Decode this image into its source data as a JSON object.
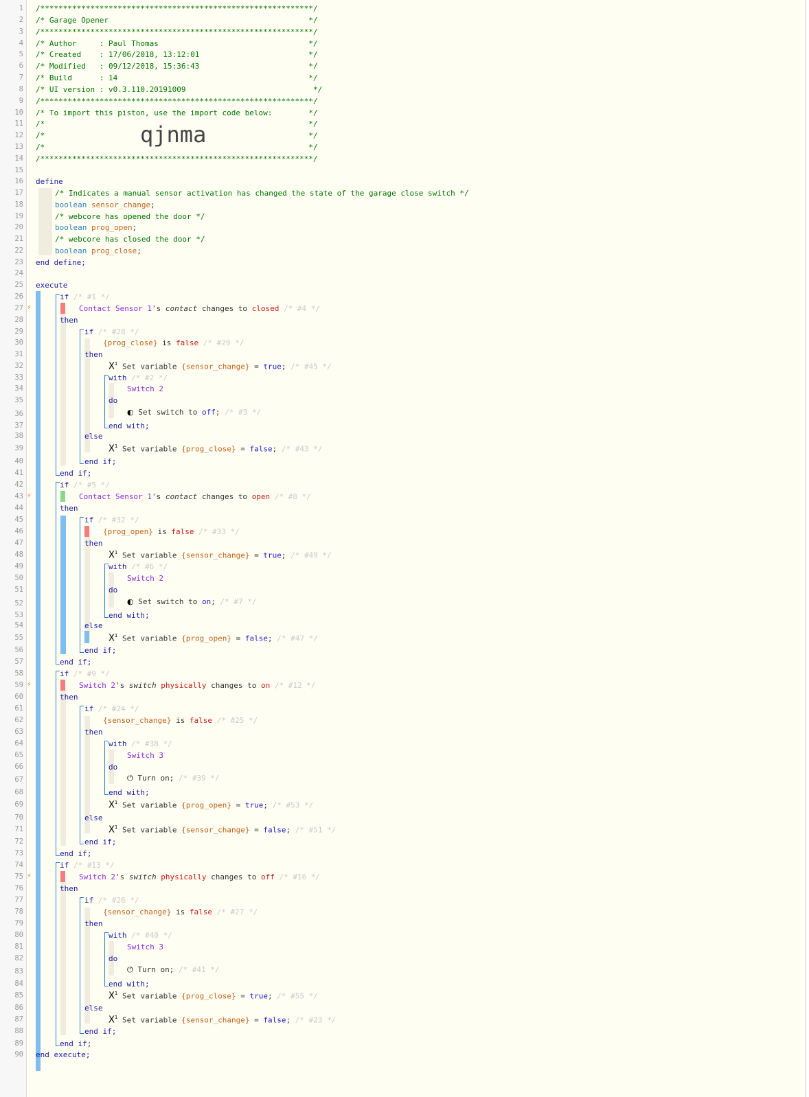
{
  "header": {
    "l1": "/************************************************************/",
    "title": "/* Garage Opener                                            */",
    "l3": "/************************************************************/",
    "author": "/* Author     : Paul Thomas                                 */",
    "created": "/* Created    : 17/06/2018, 13:12:01                        */",
    "modified": "/* Modified   : 09/12/2018, 15:36:43                        */",
    "build": "/* Build      : 14                                          */",
    "uiver": "/* UI version : v0.3.110.20191009                            */",
    "l9": "/************************************************************/",
    "import": "/* To import this piston, use the import code below:        */",
    "l11": "/*                                                          */",
    "l12": "/*                                                          */",
    "l13": "/*                                                          */",
    "l14": "/************************************************************/",
    "code": "qjnma"
  },
  "kw": {
    "define": "define",
    "enddefine": "end define;",
    "execute": "execute",
    "endexecute": "end execute;",
    "if": "if",
    "then": "then",
    "else": "else",
    "endif": "end if;",
    "with": "with",
    "do": "do",
    "endwith": "end with;",
    "boolean": "boolean",
    "is": "is",
    "false": "false",
    "true": "true",
    "changes": "changes to",
    "setvar": "Set variable",
    "setswitch": "Set switch to",
    "turnon": "Turn on;",
    "s": "'s",
    "eq": "=",
    "semi": ";",
    "physically": "physically"
  },
  "defs": {
    "c1": "/* Indicates a manual sensor activation has changed the state of the garage close switch */",
    "v1": "sensor_change",
    "c2": "/* webcore has opened the door */",
    "v2": "prog_open",
    "c3": "/* webcore has closed the door */",
    "v3": "prog_close"
  },
  "devices": {
    "contact": "Contact Sensor 1",
    "switch2": "Switch 2",
    "switch3": "Switch 3"
  },
  "attrs": {
    "contact": "contact",
    "switch": "switch"
  },
  "values": {
    "closed": "closed",
    "open": "open",
    "on": "on",
    "off": "off"
  },
  "vars": {
    "sc": "{sensor_change}",
    "po": "{prog_open}",
    "pc": "{prog_close}"
  },
  "ids": {
    "i1": "/* #1 */",
    "i4": "/* #4 */",
    "i28": "/* #28 */",
    "i29": "/* #29 */",
    "i45": "/* #45 */",
    "i2": "/* #2 */",
    "i3": "/* #3 */",
    "i43": "/* #43 */",
    "i5": "/* #5 */",
    "i8": "/* #8 */",
    "i32": "/* #32 */",
    "i33": "/* #33 */",
    "i49": "/* #49 */",
    "i6": "/* #6 */",
    "i7": "/* #7 */",
    "i47": "/* #47 */",
    "i9": "/* #9 */",
    "i12": "/* #12 */",
    "i24": "/* #24 */",
    "i25": "/* #25 */",
    "i38": "/* #38 */",
    "i39": "/* #39 */",
    "i53": "/* #53 */",
    "i51": "/* #51 */",
    "i13": "/* #13 */",
    "i16": "/* #16 */",
    "i26": "/* #26 */",
    "i27": "/* #27 */",
    "i40": "/* #40 */",
    "i41": "/* #41 */",
    "i55": "/* #55 */",
    "i23": "/* #23 */"
  },
  "line_numbers": [
    "1",
    "2",
    "3",
    "4",
    "5",
    "6",
    "7",
    "8",
    "9",
    "10",
    "11",
    "12",
    "13",
    "14",
    "15",
    "16",
    "17",
    "18",
    "19",
    "20",
    "21",
    "22",
    "23",
    "24",
    "25",
    "26",
    "27",
    "28",
    "29",
    "30",
    "31",
    "32",
    "33",
    "34",
    "35",
    "36",
    "37",
    "38",
    "39",
    "40",
    "41",
    "42",
    "43",
    "44",
    "45",
    "46",
    "47",
    "48",
    "49",
    "50",
    "51",
    "52",
    "53",
    "54",
    "55",
    "56",
    "57",
    "58",
    "59",
    "60",
    "61",
    "62",
    "63",
    "64",
    "65",
    "66",
    "67",
    "68",
    "69",
    "70",
    "71",
    "72",
    "73",
    "74",
    "75",
    "76",
    "77",
    "78",
    "79",
    "80",
    "81",
    "82",
    "83",
    "84",
    "85",
    "86",
    "87",
    "88",
    "89",
    "90"
  ],
  "icons": {
    "bolt": "lightning-bolt-icon",
    "var": "variable-icon",
    "toggle": "toggle-icon",
    "power": "power-icon"
  },
  "colors": {
    "status_red": "#f47c7c",
    "status_green": "#8ad88a",
    "status_blue": "#7fbff0"
  }
}
